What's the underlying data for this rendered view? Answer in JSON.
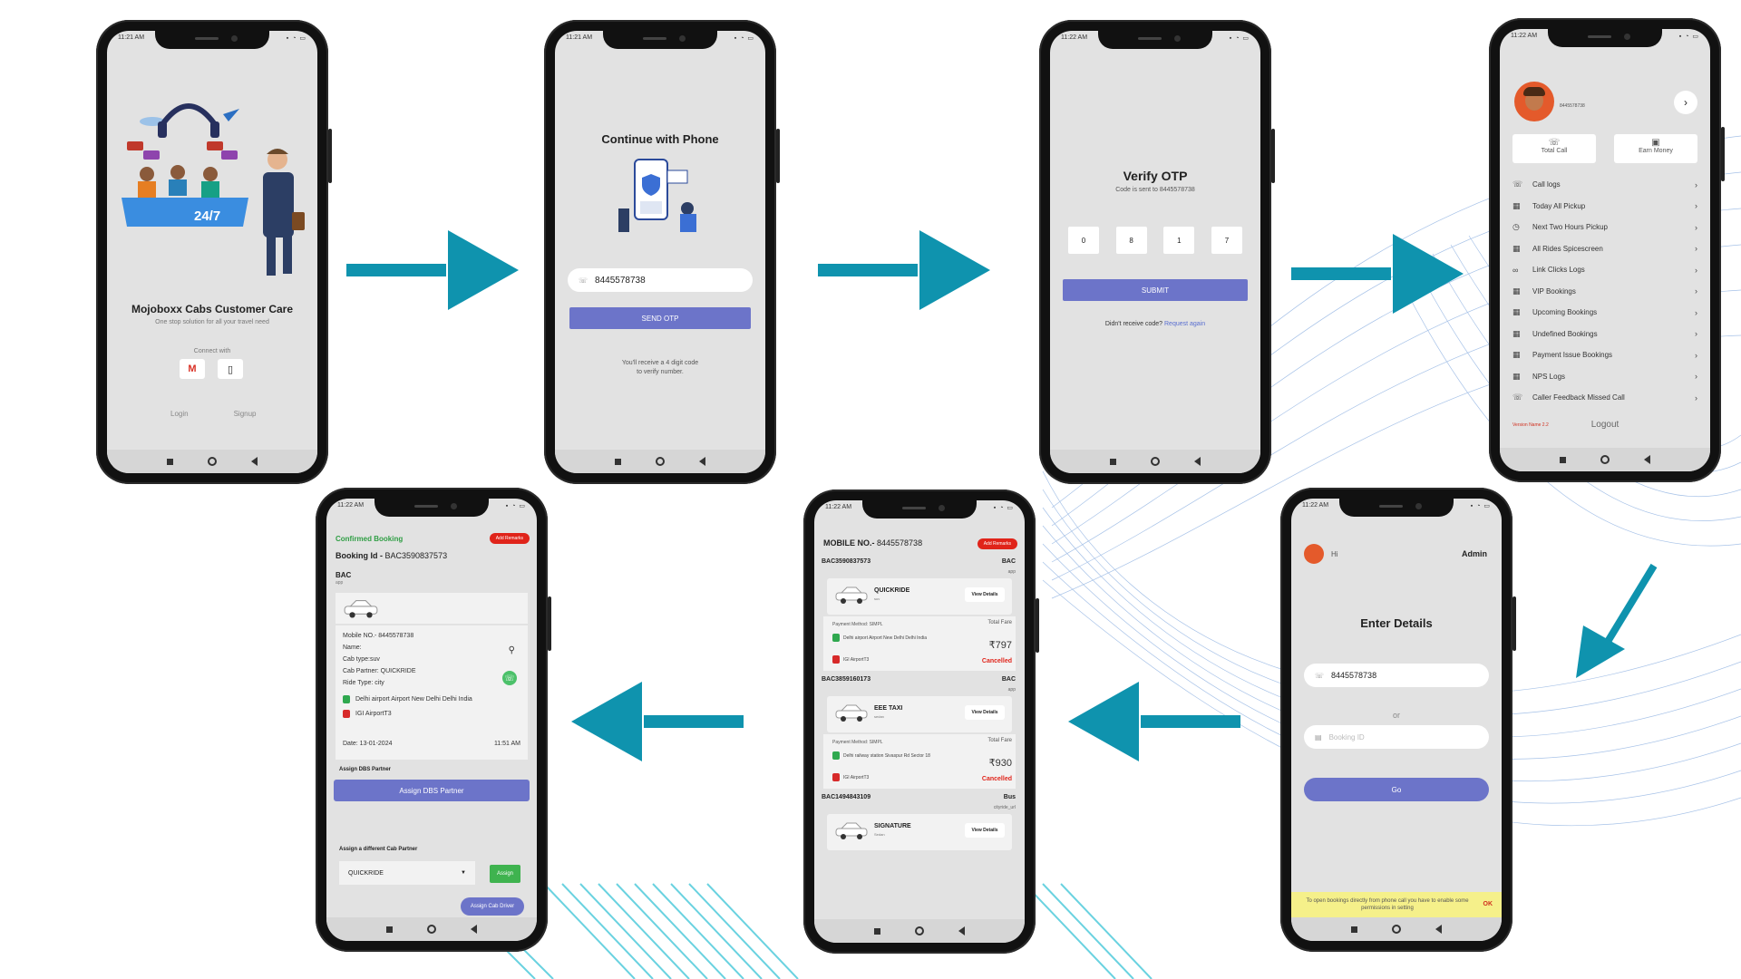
{
  "status_times": {
    "s1": "11:21 AM",
    "s2": "11:21 AM",
    "s3": "11:22 AM",
    "s4": "11:22 AM",
    "s5": "11:22 AM",
    "s6": "11:22 AM",
    "s7": "11:22 AM"
  },
  "screen_welcome": {
    "badge": "24/7",
    "title": "Mojoboxx Cabs Customer Care",
    "subtitle": "One stop solution for all your travel need",
    "connect_label": "Connect with",
    "gmail_glyph": "M",
    "phone_glyph": "▯",
    "login": "Login",
    "signup": "Signup"
  },
  "screen_phone": {
    "title": "Continue with Phone",
    "phone_value": "8445578738",
    "send_otp": "SEND OTP",
    "note_line1": "You'll receive a 4 digit code",
    "note_line2": "to verify number."
  },
  "screen_otp": {
    "title": "Verify OTP",
    "subtitle": "Code is sent to 8445578738",
    "digits": [
      "0",
      "8",
      "1",
      "7"
    ],
    "submit": "SUBMIT",
    "resend_text": "Didn't receive code?",
    "resend_link": "Request again"
  },
  "screen_menu": {
    "phone": "8445578738",
    "total_call": "Total Call",
    "earn_money": "Earn Money",
    "items": [
      {
        "label": "Call logs",
        "icon": "phone-icon"
      },
      {
        "label": "Today All Pickup",
        "icon": "building-icon"
      },
      {
        "label": "Next Two Hours Pickup",
        "icon": "clock-icon"
      },
      {
        "label": "All Rides Spicescreen",
        "icon": "building-icon"
      },
      {
        "label": "Link Clicks Logs",
        "icon": "link-icon"
      },
      {
        "label": "VIP Bookings",
        "icon": "building-icon"
      },
      {
        "label": "Upcoming Bookings",
        "icon": "building-icon"
      },
      {
        "label": "Undefined Bookings",
        "icon": "building-icon"
      },
      {
        "label": "Payment Issue Bookings",
        "icon": "building-icon"
      },
      {
        "label": "NPS Logs",
        "icon": "building-icon"
      },
      {
        "label": "Caller Feedback Missed Call",
        "icon": "phone-icon"
      }
    ],
    "version": "Version Name 2.2",
    "logout": "Logout"
  },
  "screen_enter": {
    "hi": "Hi",
    "admin": "Admin",
    "title": "Enter Details",
    "phone_value": "8445578738",
    "or": "or",
    "booking_placeholder": "Booking ID",
    "go": "Go",
    "permission_note": "To open bookings directly from phone call you have to enable some permissions in setting",
    "ok": "OK"
  },
  "screen_list": {
    "mobile_label": "MOBILE NO.-",
    "mobile_value": "8445578738",
    "add_remarks": "Add Remarks",
    "bookings": [
      {
        "id": "BAC3590837573",
        "type": "BAC",
        "source": "app",
        "cab": "QUICKRIDE",
        "cls": "suv",
        "payment": "Payment Method: SIMPL",
        "total_label": "Total Fare",
        "from": "Delhi airport Airport New Delhi Delhi India",
        "to": "IGI AirportT3",
        "fare": "₹797",
        "status": "Cancelled"
      },
      {
        "id": "BAC3859160173",
        "type": "BAC",
        "source": "app",
        "cab": "EEE TAXI",
        "cls": "sedan",
        "payment": "Payment Method: SIMPL",
        "total_label": "Total Fare",
        "from": "Delhi railway station Sivaspur Rd Sector 18",
        "to": "IGI AirportT3",
        "fare": "₹930",
        "status": "Cancelled"
      },
      {
        "id": "BAC1494843109",
        "type": "Bus",
        "source": "cityride_url",
        "cab": "SIGNATURE",
        "cls": "Sedan"
      }
    ],
    "view_details": "View Details"
  },
  "screen_confirmed": {
    "status": "Confirmed Booking",
    "add_remarks": "Add Remarks",
    "booking_label": "Booking Id -",
    "booking_id": "BAC3590837573",
    "vendor": "BAC",
    "source": "app",
    "mobile": "Mobile NO.- 8445578738",
    "name": "Name:",
    "cab_type": "Cab type:suv",
    "cab_partner": "Cab Partner: QUICKRIDE",
    "ride_type": "Ride Type: city",
    "from": "Delhi airport Airport New Delhi Delhi India",
    "to": "IGI AirportT3",
    "date": "Date: 13-01-2024",
    "time": "11:51 AM",
    "assign_dbs_title": "Assign DBS Partner",
    "assign_dbs_btn": "Assign DBS Partner",
    "assign_diff_title": "Assign a different Cab Partner",
    "select_value": "QUICKRIDE",
    "assign_btn": "Assign",
    "assign_driver": "Assign Cab Driver"
  },
  "colors": {
    "primary": "#6c74c9",
    "teal_arrow": "#0f93ae",
    "danger": "#e0241a",
    "success": "#3fb34f"
  }
}
